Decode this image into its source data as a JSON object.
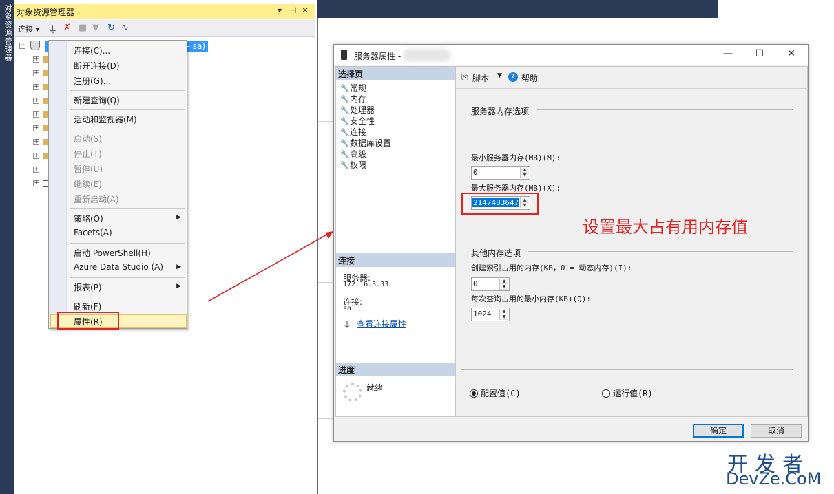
{
  "vertical_tab": {
    "label": "对象资源管理器"
  },
  "object_explorer": {
    "title": "对象资源管理器",
    "pin_label": "▾ ⊣ ✕",
    "toolbar": {
      "connect": "连接 ▾"
    },
    "server_node_suffix": "- sa)"
  },
  "context_menu": {
    "items": [
      "连接(C)...",
      "断开连接(D)",
      "注册(G)...",
      "新建查询(Q)",
      "活动和监视器(M)",
      "启动(S)",
      "停止(T)",
      "暂停(U)",
      "继续(E)",
      "重新启动(A)",
      "策略(O)",
      "Facets(A)",
      "启动 PowerShell(H)",
      "Azure Data Studio (A)",
      "报表(P)",
      "刷新(F)",
      "属性(R)"
    ]
  },
  "dialog": {
    "title": "服务器属性 -",
    "select_page_header": "选择页",
    "pages": [
      "常规",
      "内存",
      "处理器",
      "安全性",
      "连接",
      "数据库设置",
      "高级",
      "权限"
    ],
    "connection_header": "连接",
    "server_label": "服务器:",
    "server_value": "172.16.3.33",
    "conn_label": "连接:",
    "conn_value": "sa",
    "view_conn_props": "查看连接属性",
    "progress_header": "进度",
    "progress_status": "就绪",
    "toolbar": {
      "script": "脚本",
      "help": "帮助"
    },
    "memory_group": "服务器内存选项",
    "min_label": "最小服务器内存(MB)(M):",
    "min_value": "0",
    "max_label": "最大服务器内存(MB)(X):",
    "max_value": "2147483647",
    "other_group": "其他内存选项",
    "index_label": "创建索引占用的内存(KB，0 = 动态内存)(I):",
    "index_value": "0",
    "query_label": "每次查询占用的最小内存(KB)(Q):",
    "query_value": "1024",
    "radio_config": "配置值(C)",
    "radio_running": "运行值(R)",
    "ok": "确定",
    "cancel": "取消"
  },
  "annotation": "设置最大占有用内存值",
  "watermark": {
    "line1": "开发者",
    "line2": "DevZe.CoM"
  },
  "colors": {
    "accent_red": "#e02424",
    "selection_blue": "#3399ff",
    "title_yellow": "#ffef8f"
  }
}
